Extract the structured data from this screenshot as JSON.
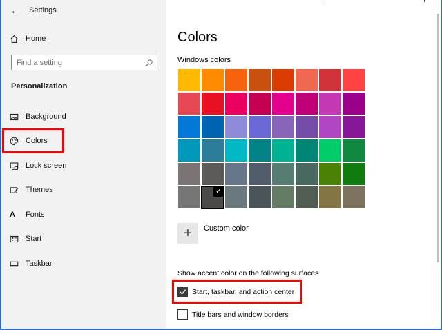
{
  "window": {
    "title": "Settings",
    "back_icon": "back-arrow-icon"
  },
  "sidebar": {
    "home_label": "Home",
    "search": {
      "placeholder": "Find a setting",
      "value": ""
    },
    "section_heading": "Personalization",
    "items": [
      {
        "label": "Background",
        "icon": "picture-icon"
      },
      {
        "label": "Colors",
        "icon": "palette-icon"
      },
      {
        "label": "Lock screen",
        "icon": "lock-screen-icon"
      },
      {
        "label": "Themes",
        "icon": "themes-icon"
      },
      {
        "label": "Fonts",
        "icon": "fonts-icon",
        "glyph": "A"
      },
      {
        "label": "Start",
        "icon": "start-icon"
      },
      {
        "label": "Taskbar",
        "icon": "taskbar-icon"
      }
    ]
  },
  "main": {
    "page_title": "Colors",
    "windows_colors_label": "Windows colors",
    "swatches": [
      [
        "#FFB900",
        "#FF8C00",
        "#F7630C",
        "#CA5010",
        "#DA3B01",
        "#EF6950",
        "#D13438",
        "#FF4343"
      ],
      [
        "#E74856",
        "#E81123",
        "#EA005E",
        "#C30052",
        "#E3008C",
        "#BF0077",
        "#C239B3",
        "#9A0089"
      ],
      [
        "#0078D7",
        "#0063B1",
        "#8E8CD8",
        "#6B69D6",
        "#8764B8",
        "#744DA9",
        "#B146C2",
        "#881798"
      ],
      [
        "#0099BC",
        "#2D7D9A",
        "#00B7C3",
        "#038387",
        "#00B294",
        "#018574",
        "#00CC6A",
        "#10893E"
      ],
      [
        "#7A7574",
        "#5D5A58",
        "#68768A",
        "#515C6B",
        "#567C73",
        "#486860",
        "#498205",
        "#107C10"
      ],
      [
        "#767676",
        "#4C4A48",
        "#69797E",
        "#4A5459",
        "#647C64",
        "#525E54",
        "#847545",
        "#7E735F"
      ]
    ],
    "selected_swatch": {
      "row": 5,
      "col": 1
    },
    "custom_color_label": "Custom color",
    "surfaces_label": "Show accent color on the following surfaces",
    "checkboxes": [
      {
        "label": "Start, taskbar, and action center",
        "checked": true
      },
      {
        "label": "Title bars and window borders",
        "checked": false
      }
    ]
  },
  "colors": {
    "highlight": "#FF0000",
    "sidebar_bg": "#F2F2F2",
    "frame": "#2F6FB7"
  }
}
